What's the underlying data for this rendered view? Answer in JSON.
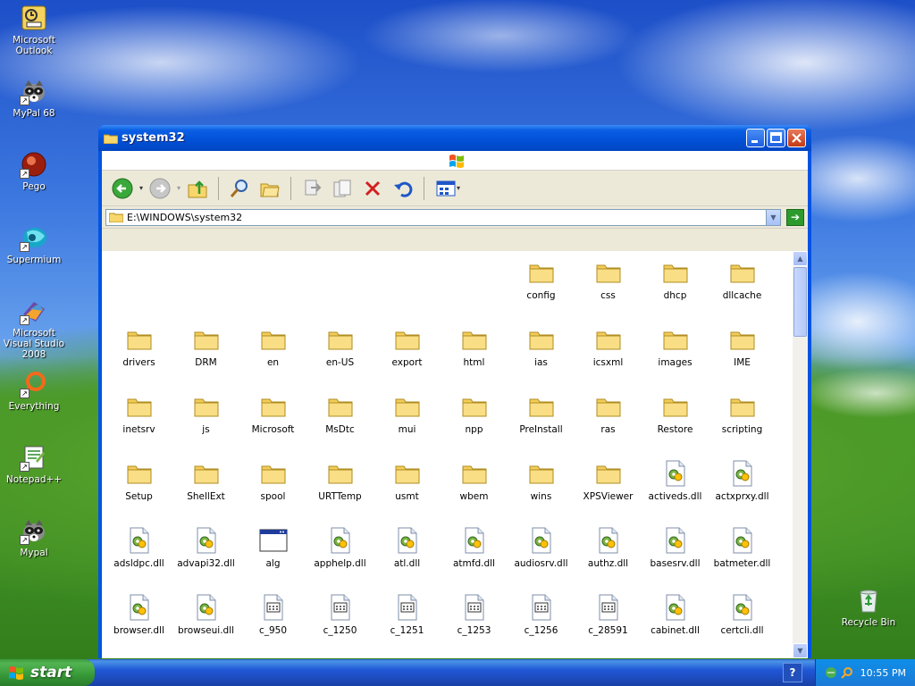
{
  "desktop_icons": [
    {
      "label": "Microsoft Outlook",
      "icon": "outlook-icon"
    },
    {
      "label": "MyPal 68",
      "icon": "raccoon-icon"
    },
    {
      "label": "Pego",
      "icon": "pego-icon"
    },
    {
      "label": "Supermium",
      "icon": "supermium-icon"
    },
    {
      "label": "Microsoft Visual Studio 2008",
      "icon": "visual-studio-icon"
    },
    {
      "label": "Everything",
      "icon": "everything-icon"
    },
    {
      "label": "Notepad++",
      "icon": "notepadpp-icon"
    },
    {
      "label": "Mypal",
      "icon": "raccoon-icon"
    },
    {
      "label": "Recycle Bin",
      "icon": "recycle-bin-icon"
    }
  ],
  "window": {
    "title": "system32",
    "address": "E:\\WINDOWS\\system32"
  },
  "files": [
    {
      "name": "config",
      "type": "folder"
    },
    {
      "name": "css",
      "type": "folder"
    },
    {
      "name": "dhcp",
      "type": "folder"
    },
    {
      "name": "dllcache",
      "type": "folder"
    },
    {
      "name": "drivers",
      "type": "folder"
    },
    {
      "name": "DRM",
      "type": "folder"
    },
    {
      "name": "en",
      "type": "folder"
    },
    {
      "name": "en-US",
      "type": "folder"
    },
    {
      "name": "export",
      "type": "folder"
    },
    {
      "name": "html",
      "type": "folder"
    },
    {
      "name": "ias",
      "type": "folder"
    },
    {
      "name": "icsxml",
      "type": "folder"
    },
    {
      "name": "images",
      "type": "folder"
    },
    {
      "name": "IME",
      "type": "folder"
    },
    {
      "name": "inetsrv",
      "type": "folder"
    },
    {
      "name": "js",
      "type": "folder"
    },
    {
      "name": "Microsoft",
      "type": "folder"
    },
    {
      "name": "MsDtc",
      "type": "folder"
    },
    {
      "name": "mui",
      "type": "folder"
    },
    {
      "name": "npp",
      "type": "folder"
    },
    {
      "name": "PreInstall",
      "type": "folder"
    },
    {
      "name": "ras",
      "type": "folder"
    },
    {
      "name": "Restore",
      "type": "folder"
    },
    {
      "name": "scripting",
      "type": "folder"
    },
    {
      "name": "Setup",
      "type": "folder"
    },
    {
      "name": "ShellExt",
      "type": "folder"
    },
    {
      "name": "spool",
      "type": "folder"
    },
    {
      "name": "URTTemp",
      "type": "folder"
    },
    {
      "name": "usmt",
      "type": "folder"
    },
    {
      "name": "wbem",
      "type": "folder"
    },
    {
      "name": "wins",
      "type": "folder"
    },
    {
      "name": "XPSViewer",
      "type": "folder"
    },
    {
      "name": "activeds.dll",
      "type": "dll"
    },
    {
      "name": "actxprxy.dll",
      "type": "dll"
    },
    {
      "name": "adsldpc.dll",
      "type": "dll"
    },
    {
      "name": "advapi32.dll",
      "type": "dll"
    },
    {
      "name": "alg",
      "type": "app"
    },
    {
      "name": "apphelp.dll",
      "type": "dll"
    },
    {
      "name": "atl.dll",
      "type": "dll"
    },
    {
      "name": "atmfd.dll",
      "type": "dll"
    },
    {
      "name": "audiosrv.dll",
      "type": "dll"
    },
    {
      "name": "authz.dll",
      "type": "dll"
    },
    {
      "name": "basesrv.dll",
      "type": "dll"
    },
    {
      "name": "batmeter.dll",
      "type": "dll"
    },
    {
      "name": "browser.dll",
      "type": "dll"
    },
    {
      "name": "browseui.dll",
      "type": "dll"
    },
    {
      "name": "c_950",
      "type": "nls"
    },
    {
      "name": "c_1250",
      "type": "nls"
    },
    {
      "name": "c_1251",
      "type": "nls"
    },
    {
      "name": "c_1253",
      "type": "nls"
    },
    {
      "name": "c_1256",
      "type": "nls"
    },
    {
      "name": "c_28591",
      "type": "nls"
    },
    {
      "name": "cabinet.dll",
      "type": "dll"
    },
    {
      "name": "certcli.dll",
      "type": "dll"
    },
    {
      "name": "",
      "type": "dll"
    },
    {
      "name": "",
      "type": "dll"
    },
    {
      "name": "",
      "type": "dll"
    },
    {
      "name": "",
      "type": "console"
    },
    {
      "name": "",
      "type": "dll"
    },
    {
      "name": "",
      "type": "dll"
    },
    {
      "name": "",
      "type": "dll"
    },
    {
      "name": "",
      "type": "dll"
    },
    {
      "name": "",
      "type": "dll"
    },
    {
      "name": "",
      "type": "dll"
    }
  ],
  "taskbar": {
    "start_label": "start",
    "help_label": "?",
    "clock": "10:55 PM"
  }
}
